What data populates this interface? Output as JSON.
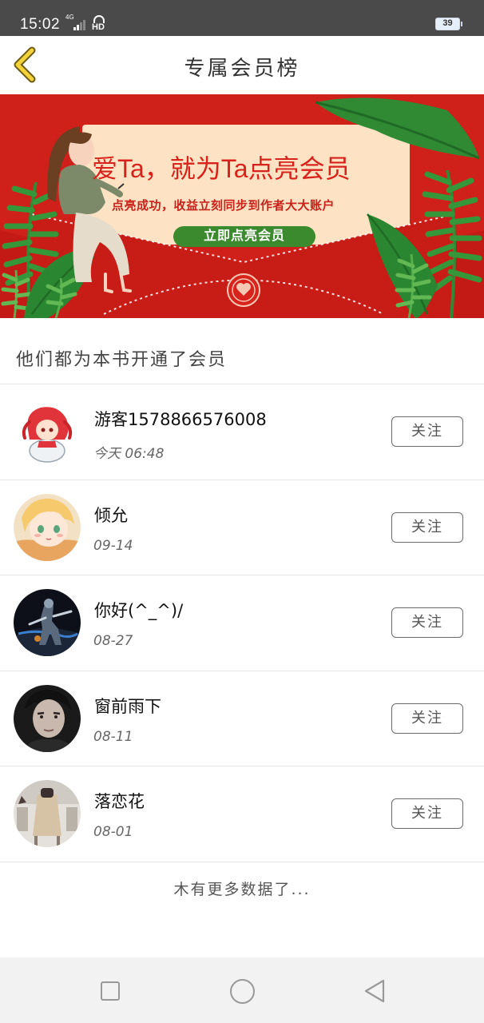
{
  "status_bar": {
    "time": "15:02",
    "network_type": "4G",
    "hd_label": "HD",
    "battery_level": "39",
    "icons": [
      "signal-icon",
      "hd-call-icon",
      "battery-icon"
    ]
  },
  "header": {
    "title": "专属会员榜",
    "back_icon": "chevron-left-icon"
  },
  "banner": {
    "headline": "爱Ta，就为Ta点亮会员",
    "subtitle": "点亮成功，收益立刻同步到作者大大账户",
    "button_label": "立即点亮会员",
    "colors": {
      "background": "#d0201a",
      "panel": "#fde3c4",
      "button": "#3b8a2e"
    }
  },
  "section": {
    "title": "他们都为本书开通了会员"
  },
  "members": [
    {
      "name": "游客1578866576008",
      "time": "今天 06:48",
      "follow_label": "关注",
      "avatar": "cartoon-redhair-avatar"
    },
    {
      "name": "倾允",
      "time": "09-14",
      "follow_label": "关注",
      "avatar": "anime-blonde-avatar"
    },
    {
      "name": "你好(^_^)/",
      "time": "08-27",
      "follow_label": "关注",
      "avatar": "game-warrior-avatar"
    },
    {
      "name": "窗前雨下",
      "time": "08-11",
      "follow_label": "关注",
      "avatar": "portrait-man-avatar"
    },
    {
      "name": "落恋花",
      "time": "08-01",
      "follow_label": "关注",
      "avatar": "fashion-photo-avatar"
    }
  ],
  "footer": {
    "no_more_text": "木有更多数据了..."
  },
  "nav_bar": {
    "icons": [
      "recent-apps-icon",
      "home-icon",
      "back-icon"
    ]
  }
}
